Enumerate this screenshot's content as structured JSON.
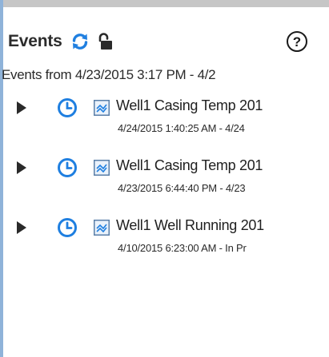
{
  "header": {
    "title": "Events",
    "refresh_icon": "refresh-icon",
    "lock_icon": "unlock-icon",
    "help_icon": "help-icon",
    "help_label": "?"
  },
  "range_text": "Events from 4/23/2015 3:17 PM - 4/2",
  "events": [
    {
      "name": "Well1 Casing Temp 201",
      "time": "4/24/2015 1:40:25 AM - 4/24"
    },
    {
      "name": "Well1 Casing Temp 201",
      "time": "4/23/2015 6:44:40 PM - 4/23"
    },
    {
      "name": "Well1 Well Running 201",
      "time": "4/10/2015 6:23:00 AM - In Pr"
    }
  ],
  "colors": {
    "accent_blue": "#1f7fe0",
    "left_border": "#8fb3d9",
    "top_bar": "#c6c6c6",
    "text": "#1f1f1f"
  }
}
